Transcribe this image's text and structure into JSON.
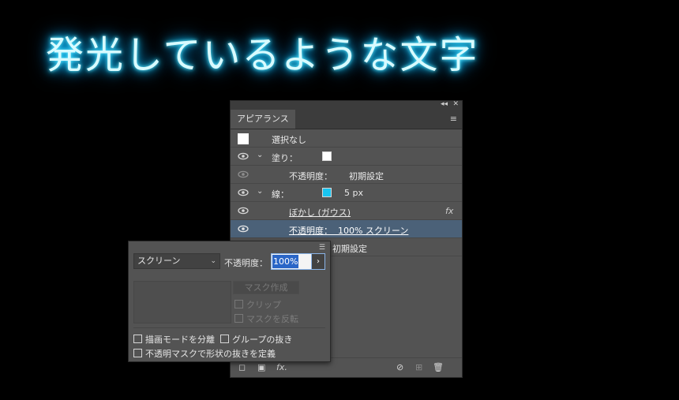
{
  "title": "発光しているような文字",
  "panel": {
    "collapse_glyph": "◂◂",
    "close_glyph": "✕",
    "tab_label": "アピアランス",
    "menu_glyph": "≡",
    "rows": {
      "no_selection": "選択なし",
      "fill_label": "塗り：",
      "fill_opacity_label": "不透明度：",
      "fill_opacity_value": "初期設定",
      "stroke_label": "線：",
      "stroke_width": "5 px",
      "effect_label": "ぼかし (ガウス)",
      "fx_glyph": "fx",
      "stroke_opacity_text": "不透明度：  100% スクリーン",
      "obj_opacity_value": "初期設定"
    },
    "colors": {
      "stroke_swatch": "#19c4f0",
      "fill_swatch": "#ffffff",
      "selected_row": "#4b6178"
    }
  },
  "footer": {
    "new_art_glyph": "◻",
    "clear_glyph": "▣",
    "fx_glyph": "fx.",
    "no_glyph": "⊘",
    "duplicate_glyph": "⊞",
    "trash_glyph": "🗑"
  },
  "popup": {
    "menu_glyph": "☰",
    "blend_mode": "スクリーン",
    "opacity_label": "不透明度：",
    "opacity_value": "100%",
    "arrow_glyph": "›",
    "make_mask": "マスク作成",
    "clip": "クリップ",
    "invert_mask": "マスクを反転",
    "isolate_blending": "描画モードを分離",
    "knockout_group": "グループの抜き",
    "opacity_mask_knockout": "不透明マスクで形状の抜きを定義"
  }
}
